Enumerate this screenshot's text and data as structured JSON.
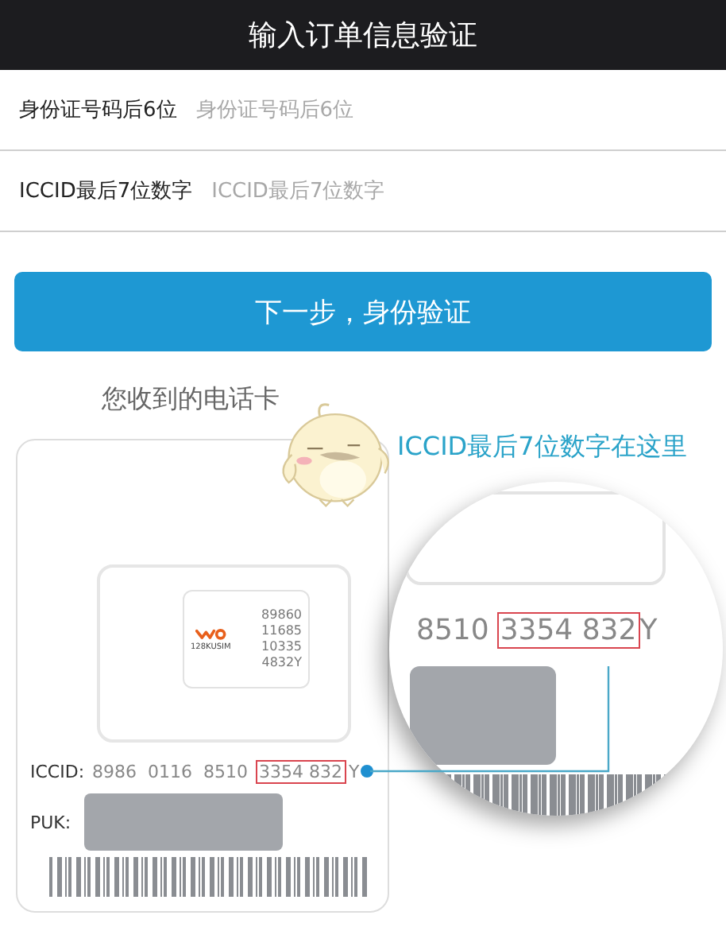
{
  "header": {
    "title": "输入订单信息验证"
  },
  "form": {
    "fields": [
      {
        "label": "身份证号码后6位",
        "placeholder": "身份证号码后6位"
      },
      {
        "label": "ICCID最后7位数字",
        "placeholder": "ICCID最后7位数字"
      }
    ]
  },
  "next_button": {
    "label": "下一步，身份验证"
  },
  "illustration": {
    "caption": "您收到的电话卡",
    "callout": "ICCID最后7位数字在这里",
    "sim_chip": {
      "brand": "128KUSIM",
      "number_lines": [
        "89860",
        "11685",
        "10335",
        "4832Y"
      ]
    },
    "card": {
      "iccid_label": "ICCID:",
      "iccid_prefix": "8986  0116  8510",
      "iccid_highlight": "3354 832",
      "iccid_suffix": "Y",
      "puk_label": "PUK:"
    },
    "magnifier": {
      "prefix": "8510",
      "highlight": "3354 832",
      "suffix": "Y"
    }
  }
}
